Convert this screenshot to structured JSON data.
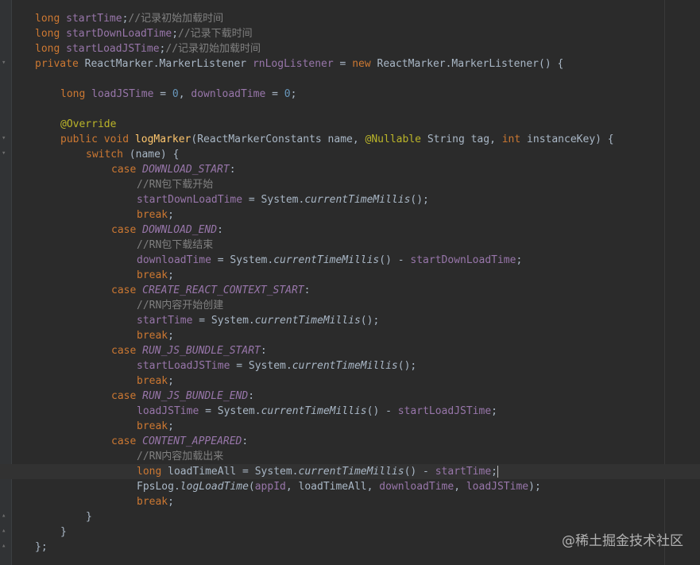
{
  "watermark": "@稀土掘金技术社区",
  "icons": [
    "fold-icon"
  ],
  "lines": [
    {
      "indent": 0,
      "tokens": [
        [
          "k",
          "long "
        ],
        [
          "f",
          "startTime"
        ],
        [
          "t",
          ";"
        ],
        [
          "c",
          "//记录初始加载时间"
        ]
      ]
    },
    {
      "indent": 0,
      "tokens": [
        [
          "k",
          "long "
        ],
        [
          "f",
          "startDownLoadTime"
        ],
        [
          "t",
          ";"
        ],
        [
          "c",
          "//记录下载时间"
        ]
      ]
    },
    {
      "indent": 0,
      "tokens": [
        [
          "k",
          "long "
        ],
        [
          "f",
          "startLoadJSTime"
        ],
        [
          "t",
          ";"
        ],
        [
          "c",
          "//记录初始加载时间"
        ]
      ]
    },
    {
      "indent": 0,
      "tokens": [
        [
          "k",
          "private "
        ],
        [
          "t",
          "ReactMarker.MarkerListener "
        ],
        [
          "f",
          "rnLogListener"
        ],
        [
          "t",
          " = "
        ],
        [
          "k",
          "new "
        ],
        [
          "t",
          "ReactMarker.MarkerListener() {"
        ]
      ]
    },
    {
      "indent": 0,
      "tokens": []
    },
    {
      "indent": 4,
      "tokens": [
        [
          "k",
          "long "
        ],
        [
          "f",
          "loadJSTime"
        ],
        [
          "t",
          " = "
        ],
        [
          "n",
          "0"
        ],
        [
          "t",
          ", "
        ],
        [
          "f",
          "downloadTime"
        ],
        [
          "t",
          " = "
        ],
        [
          "n",
          "0"
        ],
        [
          "t",
          ";"
        ]
      ]
    },
    {
      "indent": 0,
      "tokens": []
    },
    {
      "indent": 4,
      "tokens": [
        [
          "a",
          "@Override"
        ]
      ]
    },
    {
      "indent": 4,
      "tokens": [
        [
          "k",
          "public void "
        ],
        [
          "m",
          "logMarker"
        ],
        [
          "t",
          "(ReactMarkerConstants name, "
        ],
        [
          "a",
          "@Nullable "
        ],
        [
          "t",
          "String tag, "
        ],
        [
          "k",
          "int "
        ],
        [
          "t",
          "instanceKey) {"
        ]
      ]
    },
    {
      "indent": 8,
      "tokens": [
        [
          "k",
          "switch "
        ],
        [
          "t",
          "(name) {"
        ]
      ]
    },
    {
      "indent": 12,
      "tokens": [
        [
          "k",
          "case "
        ],
        [
          "fi",
          "DOWNLOAD_START"
        ],
        [
          "t",
          ":"
        ]
      ]
    },
    {
      "indent": 16,
      "tokens": [
        [
          "c",
          "//RN包下载开始"
        ]
      ]
    },
    {
      "indent": 16,
      "tokens": [
        [
          "f",
          "startDownLoadTime"
        ],
        [
          "t",
          " = System."
        ],
        [
          "si",
          "currentTimeMillis"
        ],
        [
          "t",
          "();"
        ]
      ]
    },
    {
      "indent": 16,
      "tokens": [
        [
          "k",
          "break"
        ],
        [
          "t",
          ";"
        ]
      ]
    },
    {
      "indent": 12,
      "tokens": [
        [
          "k",
          "case "
        ],
        [
          "fi",
          "DOWNLOAD_END"
        ],
        [
          "t",
          ":"
        ]
      ]
    },
    {
      "indent": 16,
      "tokens": [
        [
          "c",
          "//RN包下载结束"
        ]
      ]
    },
    {
      "indent": 16,
      "tokens": [
        [
          "f",
          "downloadTime"
        ],
        [
          "t",
          " = System."
        ],
        [
          "si",
          "currentTimeMillis"
        ],
        [
          "t",
          "() - "
        ],
        [
          "f",
          "startDownLoadTime"
        ],
        [
          "t",
          ";"
        ]
      ]
    },
    {
      "indent": 16,
      "tokens": [
        [
          "k",
          "break"
        ],
        [
          "t",
          ";"
        ]
      ]
    },
    {
      "indent": 12,
      "tokens": [
        [
          "k",
          "case "
        ],
        [
          "fi",
          "CREATE_REACT_CONTEXT_START"
        ],
        [
          "t",
          ":"
        ]
      ]
    },
    {
      "indent": 16,
      "tokens": [
        [
          "c",
          "//RN内容开始创建"
        ]
      ]
    },
    {
      "indent": 16,
      "tokens": [
        [
          "f",
          "startTime"
        ],
        [
          "t",
          " = System."
        ],
        [
          "si",
          "currentTimeMillis"
        ],
        [
          "t",
          "();"
        ]
      ]
    },
    {
      "indent": 16,
      "tokens": [
        [
          "k",
          "break"
        ],
        [
          "t",
          ";"
        ]
      ]
    },
    {
      "indent": 12,
      "tokens": [
        [
          "k",
          "case "
        ],
        [
          "fi",
          "RUN_JS_BUNDLE_START"
        ],
        [
          "t",
          ":"
        ]
      ]
    },
    {
      "indent": 16,
      "tokens": [
        [
          "f",
          "startLoadJSTime"
        ],
        [
          "t",
          " = System."
        ],
        [
          "si",
          "currentTimeMillis"
        ],
        [
          "t",
          "();"
        ]
      ]
    },
    {
      "indent": 16,
      "tokens": [
        [
          "k",
          "break"
        ],
        [
          "t",
          ";"
        ]
      ]
    },
    {
      "indent": 12,
      "tokens": [
        [
          "k",
          "case "
        ],
        [
          "fi",
          "RUN_JS_BUNDLE_END"
        ],
        [
          "t",
          ":"
        ]
      ]
    },
    {
      "indent": 16,
      "tokens": [
        [
          "f",
          "loadJSTime"
        ],
        [
          "t",
          " = System."
        ],
        [
          "si",
          "currentTimeMillis"
        ],
        [
          "t",
          "() - "
        ],
        [
          "f",
          "startLoadJSTime"
        ],
        [
          "t",
          ";"
        ]
      ]
    },
    {
      "indent": 16,
      "tokens": [
        [
          "k",
          "break"
        ],
        [
          "t",
          ";"
        ]
      ]
    },
    {
      "indent": 12,
      "tokens": [
        [
          "k",
          "case "
        ],
        [
          "fi",
          "CONTENT_APPEARED"
        ],
        [
          "t",
          ":"
        ]
      ]
    },
    {
      "indent": 16,
      "tokens": [
        [
          "c",
          "//RN内容加载出来"
        ]
      ]
    },
    {
      "indent": 16,
      "current": true,
      "tokens": [
        [
          "k",
          "long "
        ],
        [
          "t",
          "loadTimeAll = System."
        ],
        [
          "si",
          "currentTimeMillis"
        ],
        [
          "t",
          "() - "
        ],
        [
          "f",
          "startTime"
        ],
        [
          "t",
          ";"
        ]
      ]
    },
    {
      "indent": 16,
      "tokens": [
        [
          "t",
          "FpsLog."
        ],
        [
          "si",
          "logLoadTime"
        ],
        [
          "t",
          "("
        ],
        [
          "f",
          "appId"
        ],
        [
          "t",
          ", loadTimeAll, "
        ],
        [
          "f",
          "downloadTime"
        ],
        [
          "t",
          ", "
        ],
        [
          "f",
          "loadJSTime"
        ],
        [
          "t",
          ");"
        ]
      ]
    },
    {
      "indent": 16,
      "tokens": [
        [
          "k",
          "break"
        ],
        [
          "t",
          ";"
        ]
      ]
    },
    {
      "indent": 8,
      "tokens": [
        [
          "t",
          "}"
        ]
      ]
    },
    {
      "indent": 4,
      "tokens": [
        [
          "t",
          "}"
        ]
      ]
    },
    {
      "indent": 0,
      "tokens": [
        [
          "t",
          "};"
        ]
      ]
    }
  ]
}
